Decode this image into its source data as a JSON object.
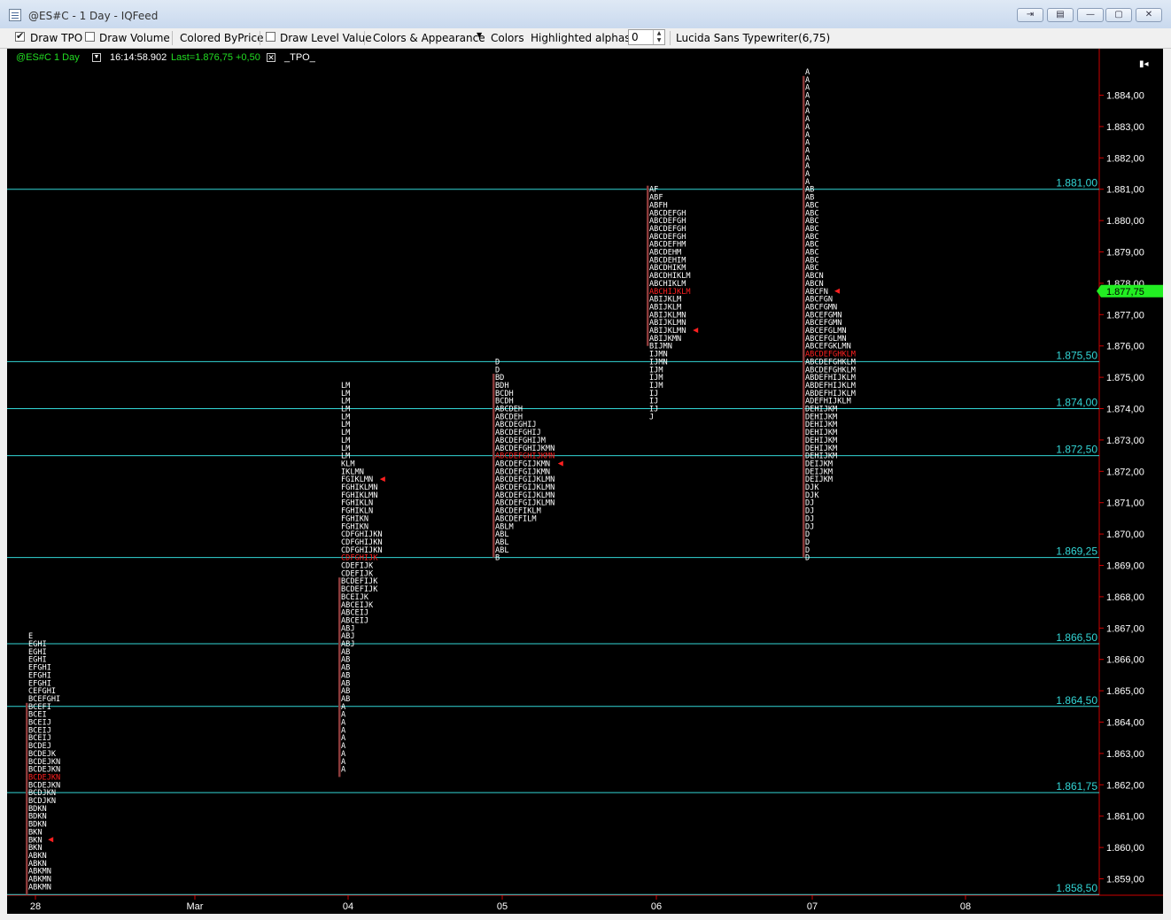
{
  "window": {
    "title": "@ES#C - 1 Day - IQFeed",
    "buttons": {
      "snap": "⇥",
      "layout": "▤",
      "minimize": "—",
      "maximize": "▢",
      "close": "✕"
    }
  },
  "toolbar": {
    "draw_tpo": {
      "label": "Draw TPO",
      "checked": true
    },
    "draw_volume": {
      "label": "Draw Volume",
      "checked": false
    },
    "colored_by_price": "Colored ByPrice",
    "draw_level_value": {
      "label": "Draw Level Value",
      "checked": false
    },
    "colors_appearance": "Colors & Appearance",
    "colors": "Colors",
    "highlighted_alphas": "Highlighted alphas",
    "alpha_value": "0",
    "font": "Lucida Sans Typewriter(6,75)"
  },
  "chart_header": {
    "symbol": "@ES#C",
    "interval": "1 Day",
    "time": "16:14:58.902",
    "last": "Last=1.876,75",
    "change": "+0,50",
    "study": "_TPO_"
  },
  "colors": {
    "background": "#000000",
    "green_text": "#22dd22",
    "axis_line": "#cc0000",
    "level_line": "#33d6d6",
    "tpo_text": "#ffffff",
    "poc_text": "#ff2020",
    "range_bar": "#8a3a3a",
    "last_price_box": "#22ee22"
  },
  "chart_data": {
    "type": "tpo_profile",
    "y_axis": {
      "ticks": [
        "1.884,00",
        "1.883,00",
        "1.882,00",
        "1.881,00",
        "1.880,00",
        "1.879,00",
        "1.878,00",
        "1.877,00",
        "1.876,00",
        "1.875,00",
        "1.874,00",
        "1.873,00",
        "1.872,00",
        "1.871,00",
        "1.870,00",
        "1.869,00",
        "1.868,00",
        "1.867,00",
        "1.866,00",
        "1.865,00",
        "1.864,00",
        "1.863,00",
        "1.862,00",
        "1.861,00",
        "1.860,00",
        "1.859,00"
      ],
      "tick_values": [
        1884,
        1883,
        1882,
        1881,
        1880,
        1879,
        1878,
        1877,
        1876,
        1875,
        1874,
        1873,
        1872,
        1871,
        1870,
        1869,
        1868,
        1867,
        1866,
        1865,
        1864,
        1863,
        1862,
        1861,
        1860,
        1859
      ],
      "ylim": [
        1858.5,
        1886
      ]
    },
    "tick_size": 0.25,
    "last_price": {
      "label": "1.877,75",
      "value": 1877.75
    },
    "x_labels": [
      {
        "label": "28",
        "index": 0
      },
      {
        "label": "Mar",
        "index": 1
      },
      {
        "label": "04",
        "index": 2
      },
      {
        "label": "05",
        "index": 3
      },
      {
        "label": "06",
        "index": 4
      },
      {
        "label": "07",
        "index": 5
      },
      {
        "label": "08",
        "index": 6
      }
    ],
    "levels": [
      {
        "label": "1.881,00",
        "value": 1881.0
      },
      {
        "label": "1.875,50",
        "value": 1875.5
      },
      {
        "label": "1.874,00",
        "value": 1874.0
      },
      {
        "label": "1.872,50",
        "value": 1872.5
      },
      {
        "label": "1.869,25",
        "value": 1869.25
      },
      {
        "label": "1.866,50",
        "value": 1866.5
      },
      {
        "label": "1.864,50",
        "value": 1864.5
      },
      {
        "label": "1.861,75",
        "value": 1861.75
      },
      {
        "label": "1.858,50",
        "value": 1858.5
      }
    ],
    "profiles": [
      {
        "date": "28",
        "x_index": 0,
        "top": 1866.75,
        "poc_row": 18,
        "marker_row": 26,
        "range": [
          1858.5,
          1864.5
        ],
        "rows": [
          "E",
          "EGHI",
          "EGHI",
          "EGHI",
          "EFGHI",
          "EFGHI",
          "EFGHI",
          "CEFGHI",
          "BCEFGHI",
          "BCEFI",
          "BCEI",
          "BCEIJ",
          "BCEIJ",
          "BCEIJ",
          "BCDEJ",
          "BCDEJK",
          "BCDEJKN",
          "BCDEJKN",
          "BCDEJKN",
          "BCDEJKN",
          "BCDJKN",
          "BCDJKN",
          "BDKN",
          "BDKN",
          "BDKN",
          "BKN",
          "BKN",
          "BKN",
          "ABKN",
          "ABKN",
          "ABKMN",
          "ABKMN",
          "ABKMN"
        ]
      },
      {
        "date": "04",
        "x_index": 2,
        "top": 1874.75,
        "poc_row": 22,
        "marker_row": 12,
        "range": [
          1862.25,
          1868.5
        ],
        "rows": [
          "LM",
          "LM",
          "LM",
          "LM",
          "LM",
          "LM",
          "LM",
          "LM",
          "LM",
          "LM",
          "KLM",
          "IKLMN",
          "FGIKLMN",
          "FGHIKLMN",
          "FGHIKLMN",
          "FGHIKLN",
          "FGHIKLN",
          "FGHIKN",
          "FGHIKN",
          "CDFGHIJKN",
          "CDFGHIJKN",
          "CDFGHIJKN",
          "CDFGHIJK",
          "CDEFIJK",
          "CDEFIJK",
          "BCDEFIJK",
          "BCDEFIJK",
          "BCEIJK",
          "ABCEIJK",
          "ABCEIJ",
          "ABCEIJ",
          "ABJ",
          "ABJ",
          "ABJ",
          "AB",
          "AB",
          "AB",
          "AB",
          "AB",
          "AB",
          "AB",
          "A",
          "A",
          "A",
          "A",
          "A",
          "A",
          "A",
          "A",
          "A"
        ]
      },
      {
        "date": "05",
        "x_index": 3,
        "top": 1875.5,
        "poc_row": 12,
        "marker_row": 13,
        "range": [
          1869.25,
          1875.0
        ],
        "rows": [
          "D",
          "D",
          "BD",
          "BDH",
          "BCDH",
          "BCDH",
          "ABCDEH",
          "ABCDEH",
          "ABCDEGHIJ",
          "ABCDEFGHIJ",
          "ABCDEFGHIJM",
          "ABCDEFGHIJKMN",
          "ABCDEFGHIJKMN",
          "ABCDEFGIJKMN",
          "ABCDEFGIJKMN",
          "ABCDEFGIJKLMN",
          "ABCDEFGIJKLMN",
          "ABCDEFGIJKLMN",
          "ABCDEFGIJKLMN",
          "ABCDEFIKLM",
          "ABCDEFILM",
          "ABLM",
          "ABL",
          "ABL",
          "ABL",
          "B"
        ]
      },
      {
        "date": "06",
        "x_index": 4,
        "top": 1881.0,
        "poc_row": 13,
        "marker_row": 18,
        "range": [
          1876.0,
          1881.0
        ],
        "rows": [
          "AF",
          "ABF",
          "ABFH",
          "ABCDEFGH",
          "ABCDEFGH",
          "ABCDEFGH",
          "ABCDEFGH",
          "ABCDEFHM",
          "ABCDEHM",
          "ABCDEHIM",
          "ABCDHIKM",
          "ABCDHIKLM",
          "ABCHIKLM",
          "ABCHIJKLM",
          "ABIJKLM",
          "ABIJKLM",
          "ABIJKLMN",
          "ABIJKLMN",
          "ABIJKLMN",
          "ABIJKMN",
          "BIJMN",
          "IJMN",
          "IJMN",
          "IJM",
          "IJM",
          "IJM",
          "IJ",
          "IJ",
          "IJ",
          "J"
        ]
      },
      {
        "date": "07",
        "x_index": 5,
        "top": 1884.75,
        "poc_row": 36,
        "marker_row": 28,
        "range": [
          1869.25,
          1884.5
        ],
        "rows": [
          "A",
          "A",
          "A",
          "A",
          "A",
          "A",
          "A",
          "A",
          "A",
          "A",
          "A",
          "A",
          "A",
          "A",
          "A",
          "AB",
          "AB",
          "ABC",
          "ABC",
          "ABC",
          "ABC",
          "ABC",
          "ABC",
          "ABC",
          "ABC",
          "ABC",
          "ABCN",
          "ABCN",
          "ABCFN",
          "ABCFGN",
          "ABCFGMN",
          "ABCEFGMN",
          "ABCEFGMN",
          "ABCEFGLMN",
          "ABCEFGLMN",
          "ABCEFGKLMN",
          "ABCDEFGHKLM",
          "ABCDEFGHKLM",
          "ABCDEFGHKLM",
          "ABDEFHIJKLM",
          "ABDEFHIJKLM",
          "ABDEFHIJKLM",
          "ADEFHIJKLM",
          "DEHIJKM",
          "DEHIJKM",
          "DEHIJKM",
          "DEHIJKM",
          "DEHIJKM",
          "DEHIJKM",
          "DEHIJKM",
          "DEIJKM",
          "DEIJKM",
          "DEIJKM",
          "DJK",
          "DJK",
          "DJ",
          "DJ",
          "DJ",
          "DJ",
          "D",
          "D",
          "D",
          "D"
        ]
      }
    ]
  }
}
